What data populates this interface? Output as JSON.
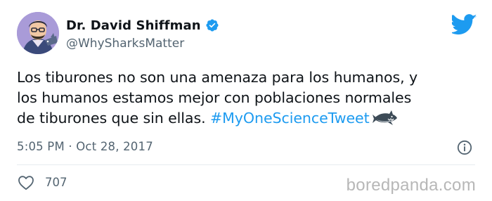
{
  "author": {
    "name": "Dr. David Shiffman",
    "handle": "@WhySharksMatter",
    "verified": true,
    "avatar_background": "#a99bd8"
  },
  "tweet": {
    "line1": "Los tiburones no son una amenaza para los humanos, y",
    "line2": "los humanos estamos mejor con poblaciones normales",
    "line3_prefix": "de tiburones que sin ellas. ",
    "hashtag": "#MyOneScienceTweet",
    "emoji": "shark-emoji"
  },
  "meta": {
    "time": "5:05 PM",
    "separator": "·",
    "date": "Oct 28, 2017"
  },
  "engagement": {
    "likes": "707"
  },
  "watermark": {
    "text": "boredpanda.com"
  },
  "icons": {
    "logo": "twitter-bird-icon",
    "verified": "verified-check-icon",
    "info": "info-icon",
    "like": "heart-outline-icon"
  },
  "colors": {
    "text": "#0f1419",
    "secondary": "#536471",
    "accent": "#1d9bf0",
    "divider": "#e6ecf0",
    "watermark": "#b7b7b7"
  }
}
